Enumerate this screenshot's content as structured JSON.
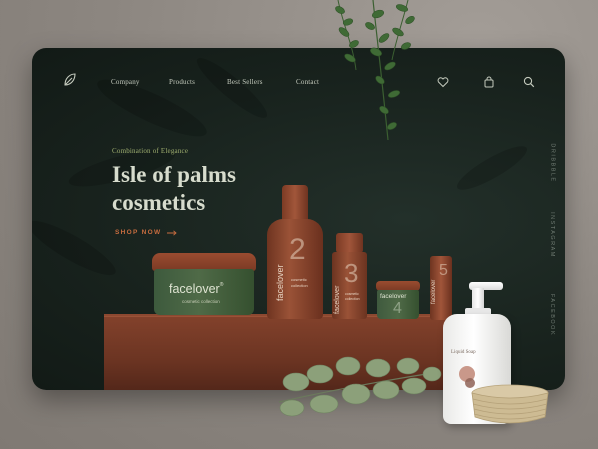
{
  "nav": {
    "items": [
      "Company",
      "Products",
      "Best Sellers",
      "Contact"
    ],
    "icons": [
      "leaf-logo-icon",
      "heart-icon",
      "bag-icon",
      "search-icon"
    ]
  },
  "hero": {
    "tagline": "Combination of Elegance",
    "title_line1": "Isle of palms",
    "title_line2": "cosmetics",
    "cta": "SHOP NOW"
  },
  "social": [
    "DRIBBBLE",
    "INSTAGRAM",
    "FACEBOOK"
  ],
  "products": {
    "brand": "facelover",
    "reg": "®",
    "jar_sub": "cosmetic collection",
    "bottle_sub1": "cosmetic",
    "bottle_sub2": "collection",
    "num2": "2",
    "num3": "3",
    "num4": "4",
    "num5": "5"
  },
  "soap": {
    "label": "Liquid Soap"
  },
  "colors": {
    "screen_bg": "#18221d",
    "accent_green": "#9fae6f",
    "accent_orange": "#c76c3f",
    "terracotta": "#8c4830"
  }
}
